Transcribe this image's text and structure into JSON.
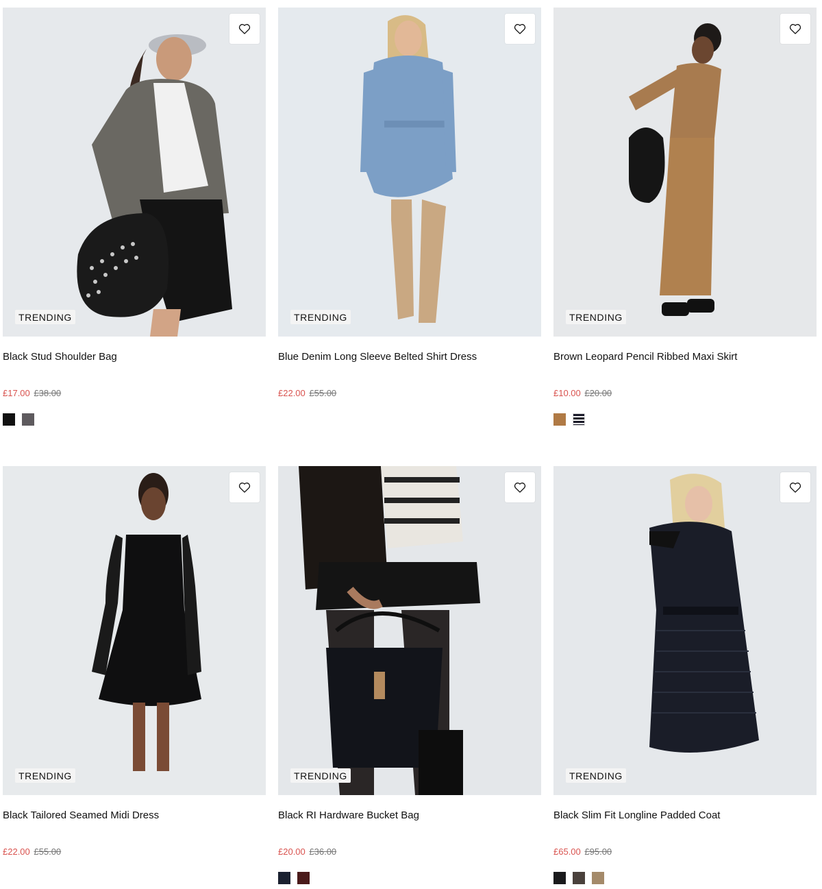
{
  "products": [
    {
      "title": "Black Stud Shoulder Bag",
      "badge": "TRENDING",
      "price_now": "£17.00",
      "price_was": "£38.00",
      "image_bg": "#e6e9ec",
      "swatches": [
        "#111111",
        "#5e5a5e"
      ]
    },
    {
      "title": "Blue Denim Long Sleeve Belted Shirt Dress",
      "badge": "TRENDING",
      "price_now": "£22.00",
      "price_was": "£55.00",
      "image_bg": "#e5eaee",
      "swatches": []
    },
    {
      "title": "Brown Leopard Pencil Ribbed Maxi Skirt",
      "badge": "TRENDING",
      "price_now": "£10.00",
      "price_was": "£20.00",
      "image_bg": "#e6e8ea",
      "swatches": [
        "#b07a45",
        "stripe"
      ]
    },
    {
      "title": "Black Tailored Seamed Midi Dress",
      "badge": "TRENDING",
      "price_now": "£22.00",
      "price_was": "£55.00",
      "image_bg": "#e7eaec",
      "swatches": []
    },
    {
      "title": "Black RI Hardware Bucket Bag",
      "badge": "TRENDING",
      "price_now": "£20.00",
      "price_was": "£36.00",
      "image_bg": "#e4e7ea",
      "swatches": [
        "#1b2130",
        "#4a1a1a"
      ]
    },
    {
      "title": "Black Slim Fit Longline Padded Coat",
      "badge": "TRENDING",
      "price_now": "£65.00",
      "price_was": "£95.00",
      "image_bg": "#e5e8eb",
      "swatches": [
        "#1a1a1c",
        "#4a413c",
        "#a48a6a"
      ]
    }
  ],
  "colors": {
    "sale_price": "#d9534f",
    "was_price": "#777777"
  },
  "icons": {
    "wishlist": "heart-outline-icon"
  }
}
